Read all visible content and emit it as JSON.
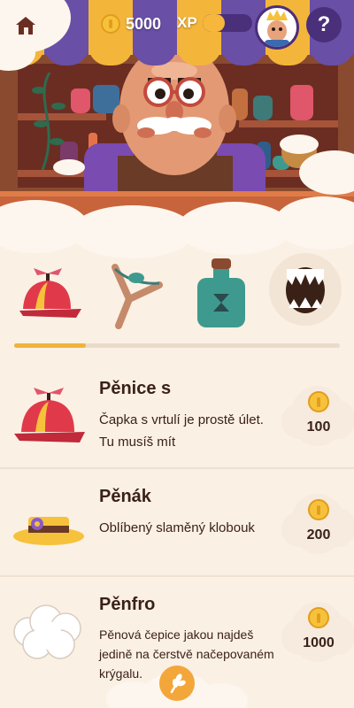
{
  "header": {
    "coins": "5000",
    "xp_label": "XP",
    "xp_progress": 0.45
  },
  "icons": {
    "home": "home-icon",
    "coin": "coin-icon",
    "help": "?",
    "fab": "wheat-icon"
  },
  "carousel": {
    "items": [
      {
        "name": "propeller-cap"
      },
      {
        "name": "slingshot"
      },
      {
        "name": "potion-bottle"
      },
      {
        "name": "shark-jaw"
      }
    ],
    "scroll_progress": 0.22
  },
  "products": [
    {
      "title": "Pěnice s",
      "description": "Čapka s vrtulí je prostě úlet. Tu musíš mít",
      "price": "100"
    },
    {
      "title": "Pěnák",
      "description": "Oblíbený slaměný klobouk",
      "price": "200"
    },
    {
      "title": "Pěnfro",
      "description": "Pěnová čepice jakou najdeš jedině na čerstvě načepovaném  krýgalu.",
      "price": "1000"
    }
  ],
  "colors": {
    "purple": "#4a2f7a",
    "gold": "#f6c23b",
    "cream": "#fbf0e4"
  }
}
